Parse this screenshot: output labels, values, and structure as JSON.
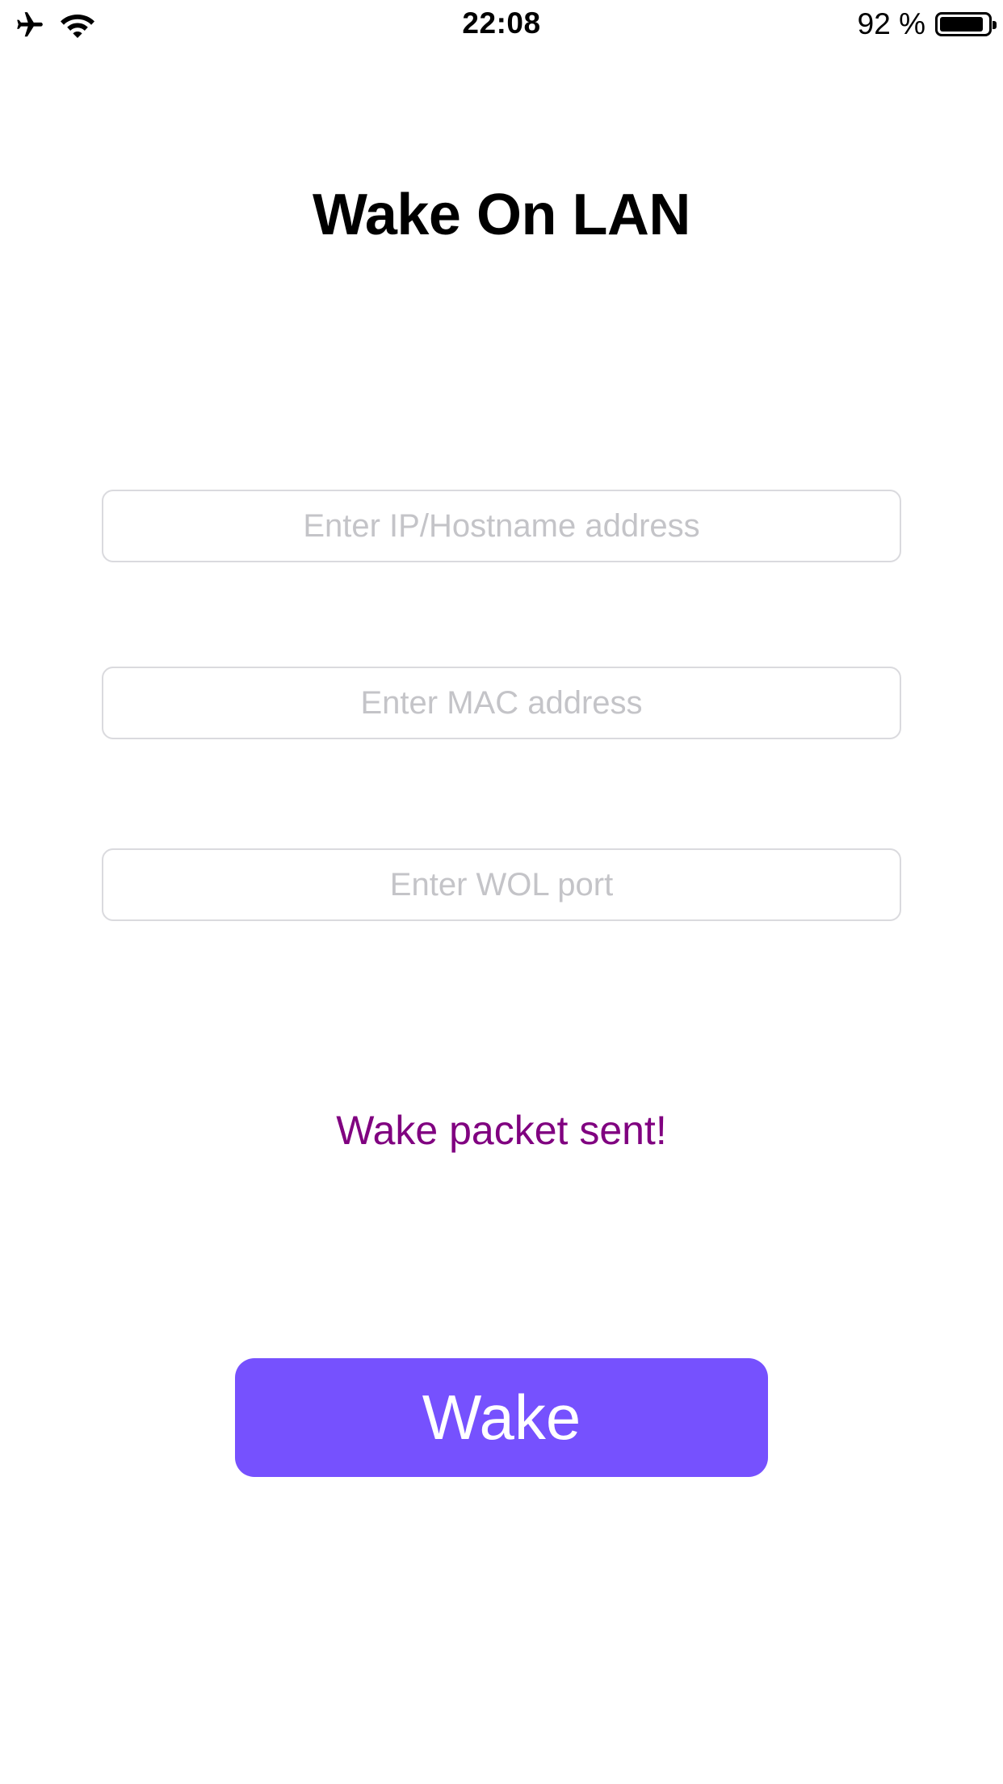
{
  "status_bar": {
    "time": "22:08",
    "battery_percent_label": "92 %",
    "battery_level": 0.92,
    "icons": [
      "airplane-icon",
      "wifi-icon",
      "battery-icon"
    ]
  },
  "header": {
    "title": "Wake On LAN"
  },
  "form": {
    "ip_placeholder": "Enter IP/Hostname address",
    "ip_value": "",
    "mac_placeholder": "Enter MAC address",
    "mac_value": "",
    "port_placeholder": "Enter WOL port",
    "port_value": ""
  },
  "status": {
    "message": "Wake packet sent!",
    "color": "#800080"
  },
  "actions": {
    "wake_label": "Wake",
    "wake_color": "#7651fe"
  }
}
